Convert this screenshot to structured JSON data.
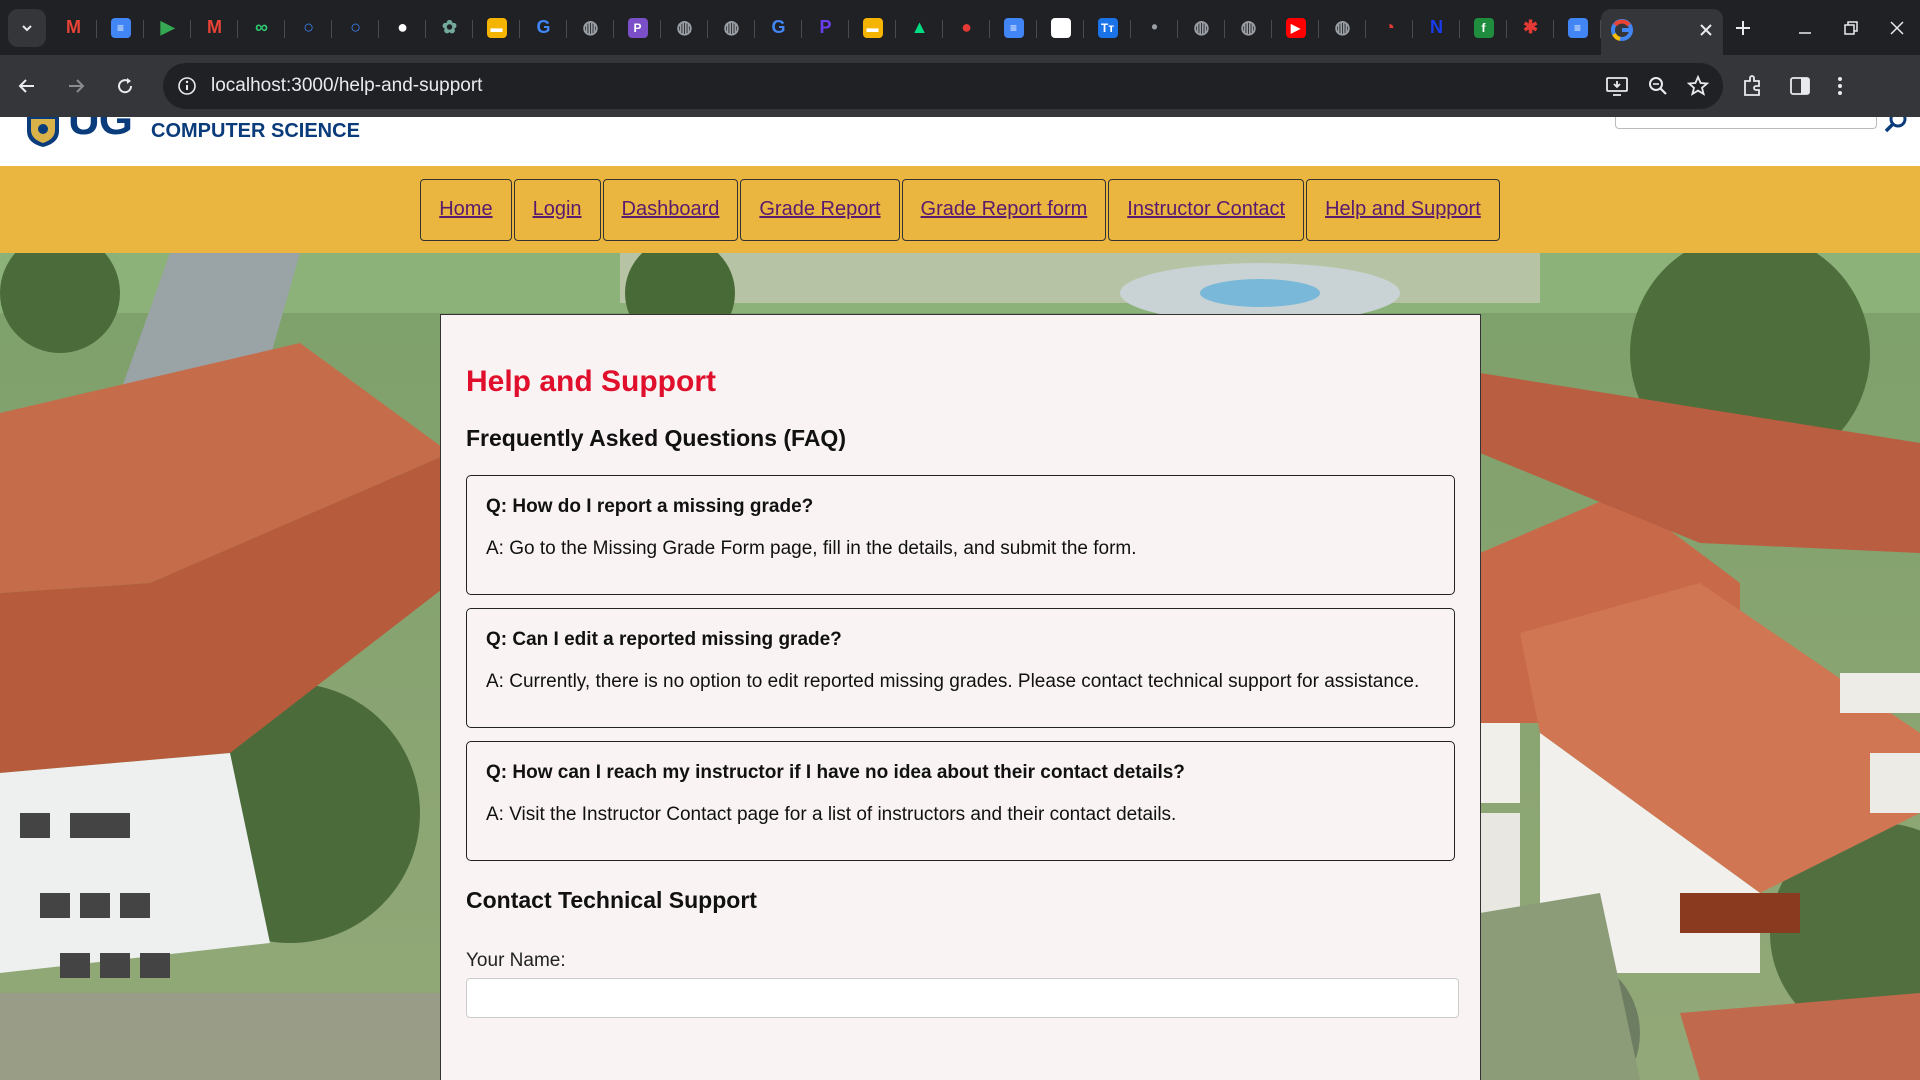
{
  "browser": {
    "tabs": [
      {
        "icon": "tab-search-icon"
      },
      {
        "icon": "gmail-icon",
        "color": "#ea4335"
      },
      {
        "icon": "docs-icon",
        "color": "#4285f4"
      },
      {
        "icon": "play-store-icon",
        "color": "#34a853"
      },
      {
        "icon": "gmail-icon",
        "color": "#ea4335"
      },
      {
        "icon": "link-icon",
        "color": "#2ecc71"
      },
      {
        "icon": "circle-app-icon",
        "color": "#3b82f6"
      },
      {
        "icon": "circle-app-icon",
        "color": "#3b82f6"
      },
      {
        "icon": "github-icon",
        "color": "#ffffff"
      },
      {
        "icon": "chatgpt-icon",
        "color": "#74aa9c"
      },
      {
        "icon": "folder-icon",
        "color": "#f4b400"
      },
      {
        "icon": "google-icon",
        "color": "#4285f4"
      },
      {
        "icon": "globe-icon",
        "color": "#9aa0a6"
      },
      {
        "icon": "p-app-icon",
        "color": "#7b4fc8"
      },
      {
        "icon": "globe-icon",
        "color": "#9aa0a6"
      },
      {
        "icon": "globe-icon",
        "color": "#9aa0a6"
      },
      {
        "icon": "google-icon",
        "color": "#4285f4"
      },
      {
        "icon": "p-logo-icon",
        "color": "#6a3df0"
      },
      {
        "icon": "folder-icon",
        "color": "#f4b400"
      },
      {
        "icon": "nuxt-icon",
        "color": "#00dc82"
      },
      {
        "icon": "record-icon",
        "color": "#e53935"
      },
      {
        "icon": "docs-icon",
        "color": "#4285f4"
      },
      {
        "icon": "news-icon",
        "color": "#ffffff"
      },
      {
        "icon": "tt-icon",
        "color": "#1a73e8"
      },
      {
        "icon": "apple-icon",
        "color": "#9aa0a6"
      },
      {
        "icon": "globe-icon",
        "color": "#9aa0a6"
      },
      {
        "icon": "globe-icon",
        "color": "#9aa0a6"
      },
      {
        "icon": "youtube-icon",
        "color": "#ff0000"
      },
      {
        "icon": "globe-icon",
        "color": "#9aa0a6"
      },
      {
        "icon": "speed-icon",
        "color": "#e53935"
      },
      {
        "icon": "n-app-icon",
        "color": "#1a3cf0"
      },
      {
        "icon": "f-app-icon",
        "color": "#1e8e3e"
      },
      {
        "icon": "gear-red-icon",
        "color": "#e53935"
      },
      {
        "icon": "docs-icon",
        "color": "#4285f4"
      }
    ],
    "active_tab_icon": "google-icon",
    "url": "localhost:3000/help-and-support"
  },
  "header": {
    "logo_text": "UG",
    "department": "COMPUTER SCIENCE"
  },
  "nav": {
    "links": [
      "Home",
      "Login",
      "Dashboard",
      "Grade Report",
      "Grade Report form",
      "Instructor Contact",
      "Help and Support"
    ]
  },
  "main": {
    "title": "Help and Support",
    "faq_heading": "Frequently Asked Questions (FAQ)",
    "faqs": [
      {
        "q": "Q: How do I report a missing grade?",
        "a": "A: Go to the Missing Grade Form page, fill in the details, and submit the form."
      },
      {
        "q": "Q: Can I edit a reported missing grade?",
        "a": "A: Currently, there is no option to edit reported missing grades. Please contact technical support for assistance."
      },
      {
        "q": "Q: How can I reach my instructor if I have no idea about their contact details?",
        "a": "A: Visit the Instructor Contact page for a list of instructors and their contact details."
      }
    ],
    "contact_heading": "Contact Technical Support",
    "name_label": "Your Name:",
    "name_value": ""
  },
  "colors": {
    "nav_bg": "#eab63f",
    "title_red": "#e0102c",
    "brand_blue": "#0a3b7a",
    "link_purple": "#5a1a6e"
  }
}
